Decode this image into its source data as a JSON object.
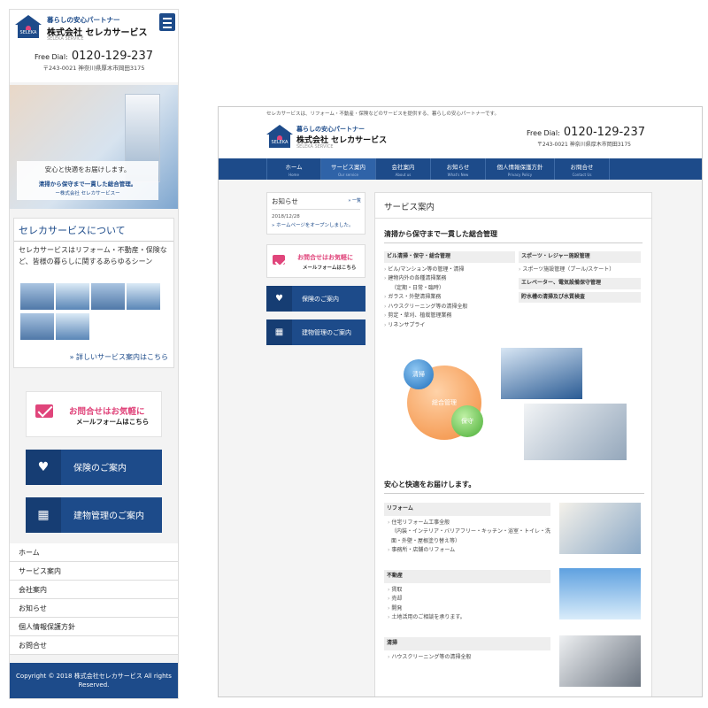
{
  "brand": {
    "tagline": "暮らしの安心パートナー",
    "company": "株式会社 セレカサービス",
    "sub": "SELEKA SERVICE",
    "logo_text": "SELEKA"
  },
  "contact": {
    "free_label": "Free Dial:",
    "free_number": "0120-129-237",
    "address": "〒243-0021 神奈川県厚木市岡田3175"
  },
  "hero": {
    "line1": "安心と快適をお届けします。",
    "line2": "清掃から保守まで一貫した総合管理。",
    "line3": "ー株式会社 セレカサービスー"
  },
  "about": {
    "title": "セレカサービスについて",
    "text": "セレカサービスはリフォーム・不動産・保険など、皆様の暮らしに関するあらゆるシーン",
    "more": "詳しいサービス案内はこちら"
  },
  "cta": {
    "mail_line1": "お問合せはお気軽に",
    "mail_line2": "メールフォームはこちら",
    "insurance": "保険のご案内",
    "building": "建物管理のご案内"
  },
  "mobile_nav": [
    "ホーム",
    "サービス案内",
    "会社案内",
    "お知らせ",
    "個人情報保護方針",
    "お問合せ"
  ],
  "footer": {
    "copyright": "Copyright © 2018 株式会社セレカサービス All rights Reserved."
  },
  "desktop": {
    "topline": "セレカサービスは、リフォーム・不動産・保険などのサービスを提供する、暮らしの安心パートナーです。",
    "nav": [
      {
        "ja": "ホーム",
        "en": "Home"
      },
      {
        "ja": "サービス案内",
        "en": "Our service"
      },
      {
        "ja": "会社案内",
        "en": "About us"
      },
      {
        "ja": "お知らせ",
        "en": "What's New"
      },
      {
        "ja": "個人情報保護方針",
        "en": "Privacy Policy"
      },
      {
        "ja": "お問合せ",
        "en": "Contact Us"
      }
    ],
    "news": {
      "title": "お知らせ",
      "list": "一覧",
      "date": "2018/12/28",
      "item": "ホームページをオープンしました。"
    },
    "main": {
      "title": "サービス案内",
      "section1": "清掃から保守まで一貫した総合管理",
      "col1": {
        "cat": "ビル清掃・保守・総合管理",
        "items": [
          "ビル/マンション等の管理・清掃",
          "建物内外の各種清掃業務",
          "（定期・日常・臨時）",
          "ガラス・外壁清掃業務",
          "ハウスクリーニング等の清掃全般",
          "剪定・草刈、植栽管理業務",
          "リネンサプライ"
        ]
      },
      "col2": {
        "cats": [
          "スポーツ・レジャー施設管理",
          "エレベーター、電気設備保守管理",
          "貯水槽の清掃及び水質検査"
        ],
        "items": [
          "スポーツ施設管理（プール/スケート）"
        ]
      },
      "circles": {
        "a": "清掃",
        "b": "総合管理",
        "c": "保守"
      },
      "section2": "安心と快適をお届けします。",
      "reform": {
        "cat": "リフォーム",
        "items": [
          "住宅リフォーム工事全般",
          "（内装・インテリア・バリアフリー・キッチン・浴室・トイレ・洗面・外壁・屋根塗り替え等）",
          "事務所・店舗のリフォーム"
        ]
      },
      "estate": {
        "cat": "不動産",
        "items": [
          "賃取",
          "売却",
          "開発",
          "土地活用のご相談を承ります。"
        ]
      },
      "clean": {
        "cat": "清掃",
        "items": [
          "ハウスクリーニング等の清掃全般"
        ]
      }
    }
  }
}
